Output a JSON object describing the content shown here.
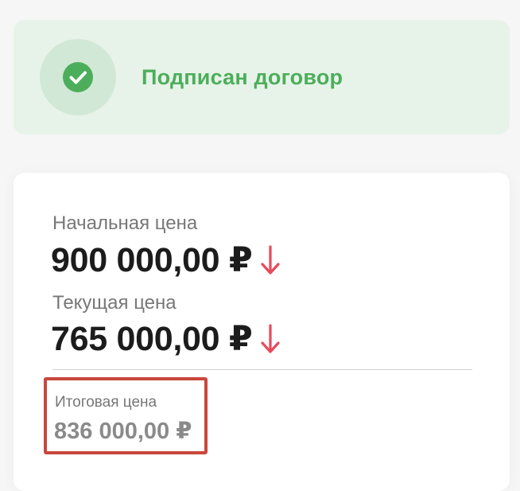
{
  "status": {
    "icon": "check-circle-icon",
    "text": "Подписан договор",
    "color": "#4cae5a"
  },
  "prices": {
    "initial_label": "Начальная цена",
    "initial_value": "900 000,00 ₽",
    "current_label": "Текущая цена",
    "current_value": "765 000,00 ₽",
    "trend_icon": "arrow-down-icon",
    "trend_color": "#e8495b",
    "final_label": "Итоговая цена",
    "final_value": "836 000,00 ₽",
    "highlight_color": "#c9473c"
  }
}
